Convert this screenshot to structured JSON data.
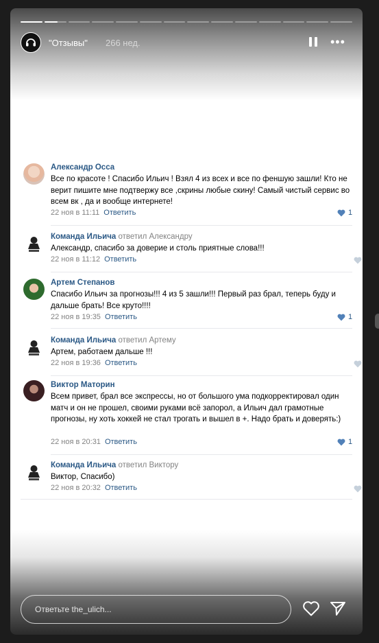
{
  "story": {
    "account": "\"Отзывы\"",
    "age": "266 нед.",
    "segments": 14,
    "active_segment": 1
  },
  "comments": [
    {
      "author": "Александр Осса",
      "reply_to": "",
      "text": "Все по красоте ! Спасибо Ильич ! Взял 4 из всех и все по феншую зашли! Кто не верит пишите мне подтвержу все ,скрины любые скину! Самый чистый сервис во всем вк , да и вообще интернете!",
      "date": "22 ноя в 11:11",
      "reply_label": "Ответить",
      "likes": "1",
      "avatar_icon": "user-photo-icon"
    },
    {
      "author": "Команда Ильича",
      "reply_to": "ответил Александру",
      "text": "Александр, спасибо за доверие и столь приятные слова!!!",
      "date": "22 ноя в 11:12",
      "reply_label": "Ответить",
      "likes": "",
      "avatar_icon": "ilyich-logo-icon"
    },
    {
      "author": "Артем Степанов",
      "reply_to": "",
      "text": "Спасибо Ильич за прогнозы!!! 4 из 5 зашли!!! Первый раз брал, теперь буду и дальше брать! Все круто!!!!",
      "date": "22 ноя в 19:35",
      "reply_label": "Ответить",
      "likes": "1",
      "avatar_icon": "user-photo-icon"
    },
    {
      "author": "Команда Ильича",
      "reply_to": "ответил Артему",
      "text": "Артем, работаем дальше !!!",
      "date": "22 ноя в 19:36",
      "reply_label": "Ответить",
      "likes": "",
      "avatar_icon": "ilyich-logo-icon"
    },
    {
      "author": "Виктор Маторин",
      "reply_to": "",
      "text": "Всем привет, брал все экспрессы, но от большого ума подкорректировал один матч и он не прошел, своими руками всё запорол, а Ильич дал грамотные прогнозы, ну хоть хоккей не стал трогать и вышел в +. Надо брать и доверять:)",
      "date": "22 ноя в 20:31",
      "reply_label": "Ответить",
      "likes": "1",
      "avatar_icon": "user-photo-icon"
    },
    {
      "author": "Команда Ильича",
      "reply_to": "ответил Виктору",
      "text": "Виктор, Спасибо)",
      "date": "22 ноя в 20:32",
      "reply_label": "Ответить",
      "likes": "",
      "avatar_icon": "ilyich-logo-icon"
    }
  ],
  "reply_bar": {
    "placeholder": "Ответьте the_ulich..."
  },
  "colors": {
    "link": "#2a5885",
    "meta": "#828282",
    "like_active": "#2a5885",
    "like_inactive": "#aab4c1"
  }
}
